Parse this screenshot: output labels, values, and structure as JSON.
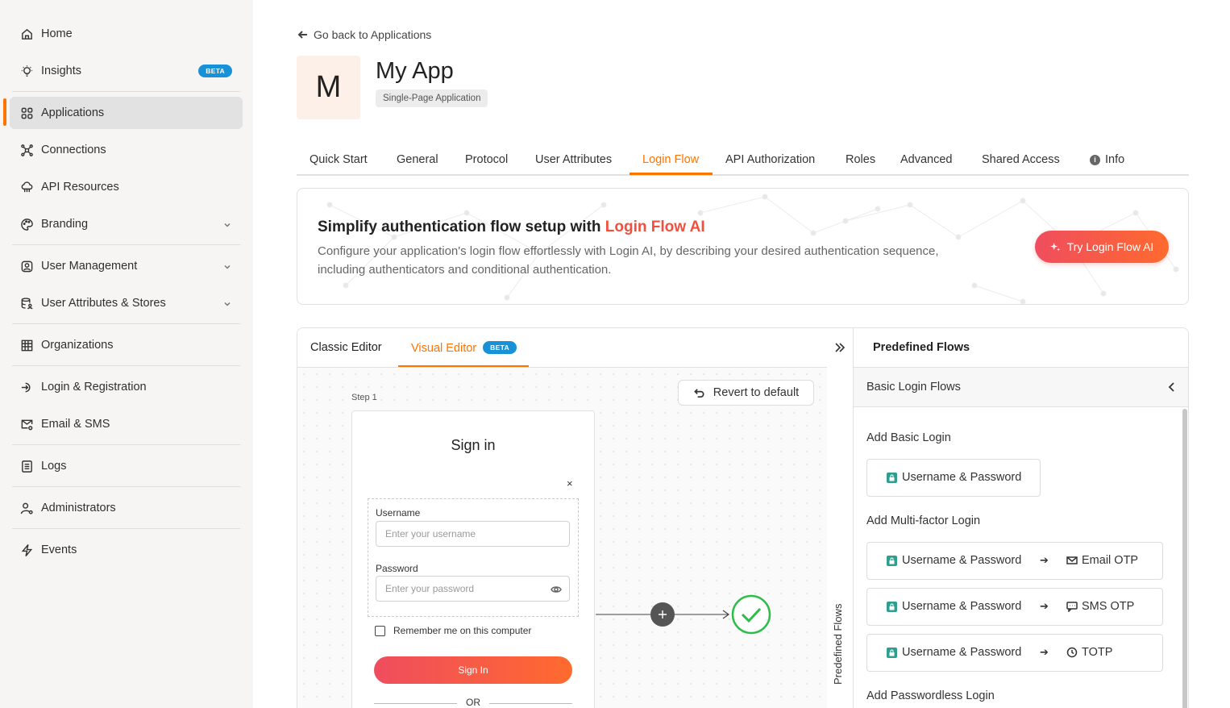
{
  "sidebar": {
    "items": [
      {
        "label": "Home"
      },
      {
        "label": "Insights",
        "badge": "BETA"
      },
      {
        "label": "Applications"
      },
      {
        "label": "Connections"
      },
      {
        "label": "API Resources"
      },
      {
        "label": "Branding"
      },
      {
        "label": "User Management"
      },
      {
        "label": "User Attributes & Stores"
      },
      {
        "label": "Organizations"
      },
      {
        "label": "Login & Registration"
      },
      {
        "label": "Email & SMS"
      },
      {
        "label": "Logs"
      },
      {
        "label": "Administrators"
      },
      {
        "label": "Events"
      }
    ]
  },
  "header": {
    "back_label": "Go back to Applications",
    "avatar_letter": "M",
    "app_name": "My App",
    "app_type": "Single-Page Application"
  },
  "tabs": [
    {
      "label": "Quick Start"
    },
    {
      "label": "General"
    },
    {
      "label": "Protocol"
    },
    {
      "label": "User Attributes"
    },
    {
      "label": "Login Flow"
    },
    {
      "label": "API Authorization"
    },
    {
      "label": "Roles"
    },
    {
      "label": "Advanced"
    },
    {
      "label": "Shared Access"
    },
    {
      "label": "Info"
    }
  ],
  "banner": {
    "title_prefix": "Simplify authentication flow setup with ",
    "title_highlight": "Login Flow AI",
    "description": "Configure your application's login flow effortlessly with Login AI, by describing your desired authentication sequence, including authenticators and conditional authentication.",
    "button_label": "Try Login Flow AI"
  },
  "editor": {
    "tabs": [
      {
        "label": "Classic Editor"
      },
      {
        "label": "Visual Editor",
        "badge": "BETA"
      }
    ],
    "revert_label": "Revert to default",
    "step_label": "Step 1",
    "signin": {
      "title": "Sign in",
      "close": "×",
      "username_label": "Username",
      "username_placeholder": "Enter your username",
      "password_label": "Password",
      "password_placeholder": "Enter your password",
      "remember_label": "Remember me on this computer",
      "button_label": "Sign In",
      "or_label": "OR"
    }
  },
  "panel": {
    "vertical_label": "Predefined Flows",
    "title": "Predefined Flows",
    "subtitle": "Basic Login Flows",
    "sections": {
      "basic": "Add Basic Login",
      "mfa": "Add Multi-factor Login",
      "passwordless": "Add Passwordless Login"
    },
    "basic_flow": "Username & Password",
    "mfa_flows": [
      {
        "first": "Username & Password",
        "arrow": "➔",
        "second": "Email OTP"
      },
      {
        "first": "Username & Password",
        "arrow": "➔",
        "second": "SMS OTP"
      },
      {
        "first": "Username & Password",
        "arrow": "➔",
        "second": "TOTP"
      }
    ]
  },
  "colors": {
    "accent": "#ff7300",
    "gradient_start": "#ef4d5e",
    "gradient_end": "#ff6a2e",
    "beta_badge": "#1792d8",
    "success_check": "#2ebd4a",
    "lock_badge": "#2f9e8f"
  }
}
